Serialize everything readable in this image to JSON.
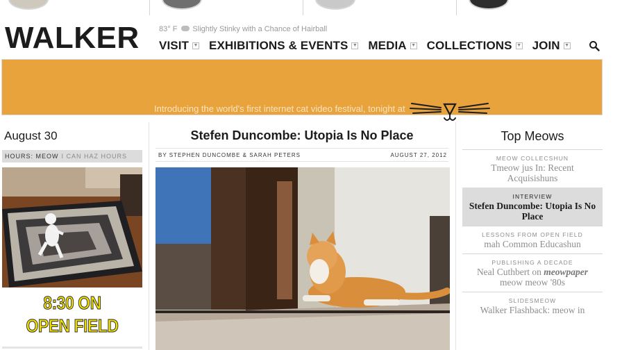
{
  "header": {
    "logo": "WALKER",
    "weather": {
      "temp": "83° F",
      "forecast": "Slightly Stinky with a Chance of Hairball",
      "icon": "cloud-icon"
    },
    "nav": [
      {
        "label": "VISIT"
      },
      {
        "label": "EXHIBITIONS & EVENTS"
      },
      {
        "label": "MEDIA"
      },
      {
        "label": "COLLECTIONS"
      },
      {
        "label": "JOIN"
      }
    ],
    "search_icon": "search-icon"
  },
  "banner": {
    "text": "Introducing the world's first internet cat video festival, tonight at",
    "color": "#e8a33d"
  },
  "left": {
    "date": "August 30",
    "hours_label": "HOURS: MEOW",
    "hours_value": "I CAN HAZ HOURS",
    "promo_line1": "8:30 ON",
    "promo_line2": "OPEN FIELD",
    "promo_color": "#f4e200"
  },
  "article": {
    "title": "Stefen Duncombe: Utopia Is No Place",
    "byline": "BY STEPHEN DUNCOMBE & SARAH PETERS",
    "date": "AUGUST 27, 2012"
  },
  "top_meows": {
    "title": "Top Meows",
    "items": [
      {
        "category": "MEOW COLLECSHUN",
        "headline": "Tmeow jus In: Recent Acquisishuns"
      },
      {
        "category": "INTERVIEW",
        "headline": "Stefen Duncombe: Utopia Is No Place",
        "active": true
      },
      {
        "category": "LESSONS FROM OPEN FIELD",
        "headline": "mah Common Educashun"
      },
      {
        "category": "PUBLISHING A DECADE",
        "headline_before": "Neal Cuthbert on ",
        "headline_em": "meowpaper",
        "headline_after": " meow meow '80s"
      },
      {
        "category": "SLIDESMEOW",
        "headline": "Walker Flashback: meow in"
      }
    ]
  }
}
